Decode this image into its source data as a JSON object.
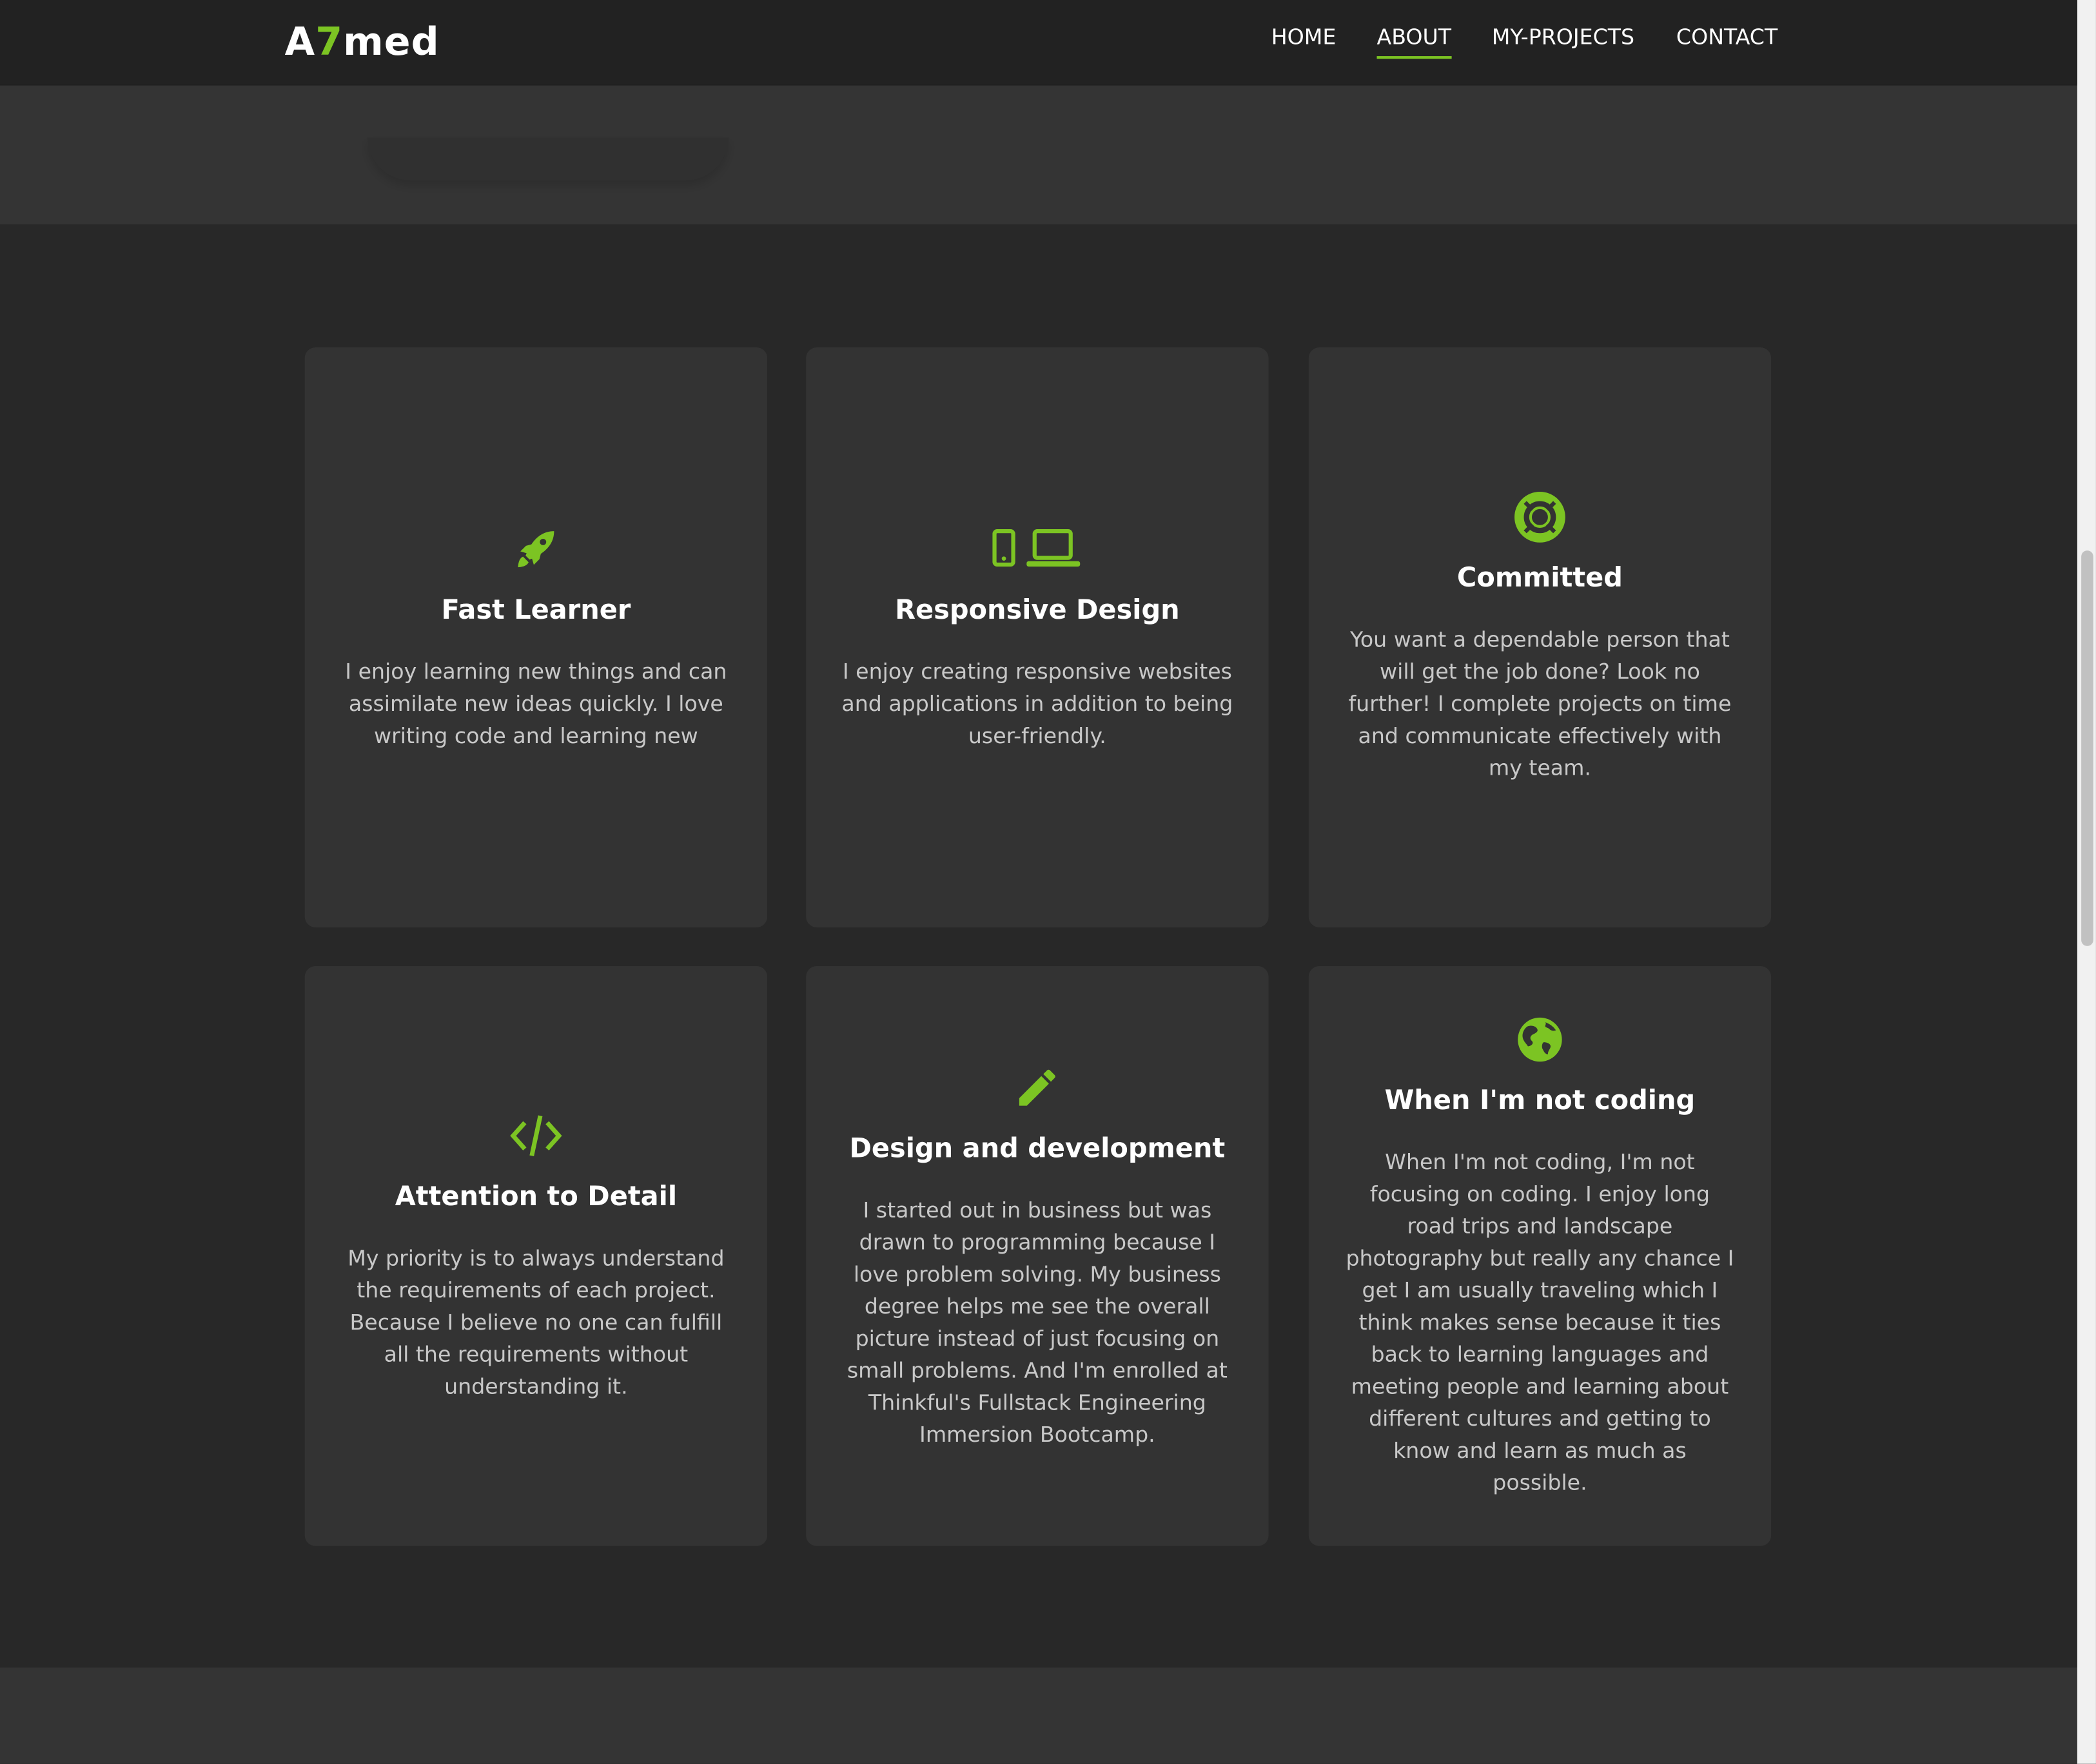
{
  "header": {
    "logo": {
      "prefix": "A",
      "accent": "7",
      "suffix": "med"
    },
    "nav": [
      {
        "label": "HOME",
        "active": false
      },
      {
        "label": "ABOUT",
        "active": true
      },
      {
        "label": "MY-PROJECTS",
        "active": false
      },
      {
        "label": "CONTACT",
        "active": false
      }
    ]
  },
  "colors": {
    "accent": "#7cc423",
    "background": "#282828",
    "card": "#333333",
    "navbar": "#222222"
  },
  "cards": [
    {
      "icon": "rocket-icon",
      "title": "Fast Learner",
      "text": "I enjoy learning new things and can assimilate new ideas quickly. I love writing code and learning new"
    },
    {
      "icon": "devices-icon",
      "title": "Responsive Design",
      "text": "I enjoy creating responsive websites and applications in addition to being user-friendly."
    },
    {
      "icon": "life-ring-icon",
      "title": "Committed",
      "text": "You want a dependable person that will get the job done? Look no further! I complete projects on time and communicate effectively with my team."
    },
    {
      "icon": "code-icon",
      "title": "Attention to Detail",
      "text": "My priority is to always understand the requirements of each project. Because I believe no one can fulfill all the requirements without understanding it."
    },
    {
      "icon": "pencil-icon",
      "title": "Design and development",
      "text": "I started out in business but was drawn to programming because I love problem solving. My business degree helps me see the overall picture instead of just focusing on small problems. And I'm enrolled at Thinkful's Fullstack Engineering Immersion Bootcamp."
    },
    {
      "icon": "globe-icon",
      "title": "When I'm not coding",
      "text": "When I'm not coding, I'm not focusing on coding. I enjoy long road trips and landscape photography but really any chance I get I am usually traveling which I think makes sense because it ties back to learning languages and meeting people and learning about different cultures and getting to know and learn as much as possible."
    }
  ]
}
